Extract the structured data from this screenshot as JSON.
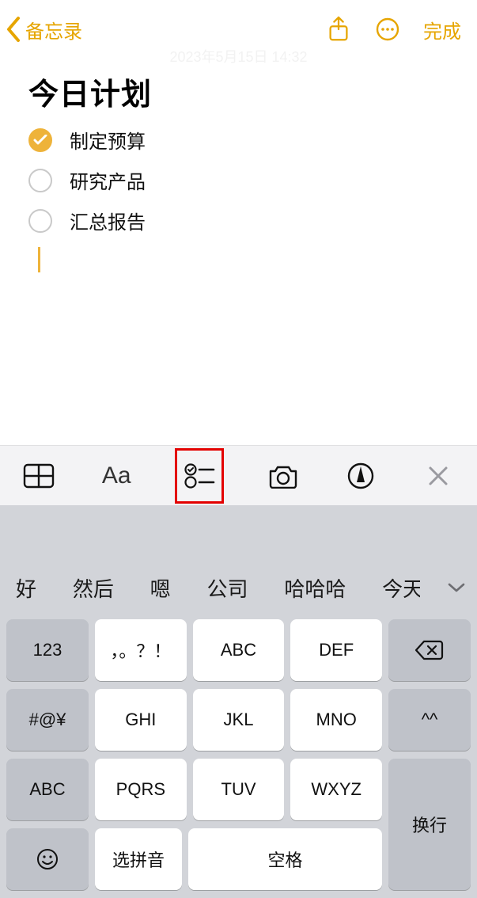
{
  "nav": {
    "back_label": "备忘录",
    "done_label": "完成"
  },
  "timestamp": "2023年5月15日 14:32",
  "note": {
    "title": "今日计划",
    "todos": [
      {
        "text": "制定预算",
        "checked": true
      },
      {
        "text": "研究产品",
        "checked": false
      },
      {
        "text": "汇总报告",
        "checked": false
      }
    ]
  },
  "toolbar": {
    "aa_label": "Aa"
  },
  "keyboard": {
    "predictions": [
      "好",
      "然后",
      "嗯",
      "公司",
      "哈哈哈",
      "今天"
    ],
    "keys": {
      "num": "123",
      "punct": "，。？！",
      "abc1": "ABC",
      "def": "DEF",
      "sym": "#@¥",
      "ghi": "GHI",
      "jkl": "JKL",
      "mno": "MNO",
      "face": "^^",
      "abc2": "ABC",
      "pqrs": "PQRS",
      "tuv": "TUV",
      "wxyz": "WXYZ",
      "pinyin": "选拼音",
      "space": "空格",
      "return": "换行"
    }
  }
}
